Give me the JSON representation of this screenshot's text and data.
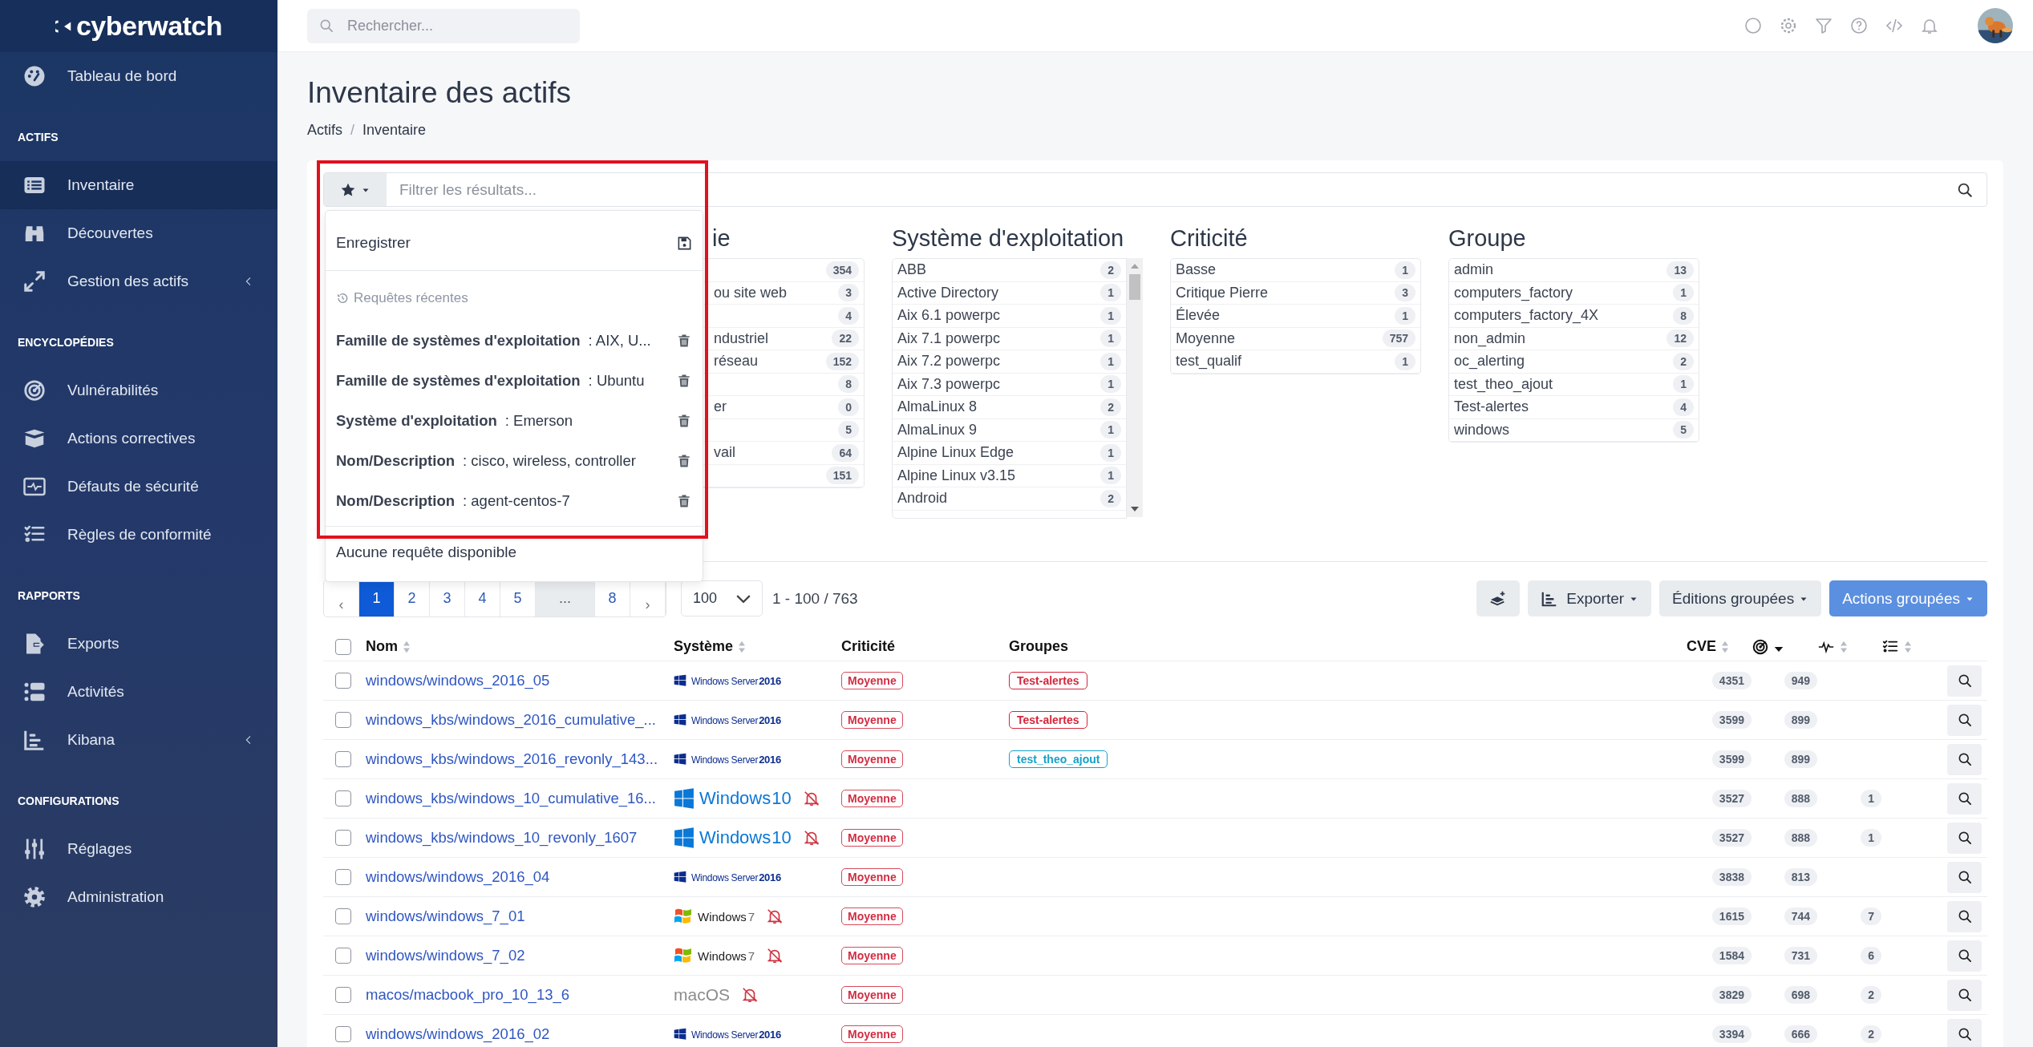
{
  "sidebar": {
    "logo": "cyberwatch",
    "sections": [
      {
        "items": [
          {
            "label": "Tableau de bord",
            "kind": "link",
            "selected": false
          }
        ]
      },
      {
        "title": "ACTIFS",
        "items": [
          {
            "label": "Inventaire",
            "kind": "link",
            "selected": true
          },
          {
            "label": "Découvertes",
            "kind": "link",
            "selected": false
          },
          {
            "label": "Gestion des actifs",
            "kind": "submenu",
            "expanded": false,
            "selected": false
          }
        ]
      },
      {
        "title": "ENCYCLOPÉDIES",
        "items": [
          {
            "label": "Vulnérabilités",
            "kind": "link",
            "selected": false
          },
          {
            "label": "Actions correctives",
            "kind": "link",
            "selected": false
          },
          {
            "label": "Défauts de sécurité",
            "kind": "link",
            "selected": false
          },
          {
            "label": "Règles de conformité",
            "kind": "link",
            "selected": false
          }
        ]
      },
      {
        "title": "RAPPORTS",
        "items": [
          {
            "label": "Exports",
            "kind": "link",
            "selected": false
          },
          {
            "label": "Activités",
            "kind": "link",
            "selected": false
          },
          {
            "label": "Kibana",
            "kind": "submenu",
            "expanded": false,
            "selected": false
          }
        ]
      },
      {
        "title": "CONFIGURATIONS",
        "items": [
          {
            "label": "Réglages",
            "kind": "link",
            "selected": false
          },
          {
            "label": "Administration",
            "kind": "link",
            "selected": false
          }
        ]
      }
    ]
  },
  "topbar": {
    "search": {
      "placeholder": "Rechercher..."
    }
  },
  "page": {
    "title": "Inventaire des actifs",
    "breadcrumb": [
      "Actifs",
      "Inventaire"
    ],
    "breadcrumb_separator": "/"
  },
  "filter": {
    "placeholder": "Filtrer les résultats...",
    "columns": [
      {
        "title": "ie",
        "scrollable": false,
        "items": [
          {
            "count": "354"
          },
          {
            "label": "ou site web",
            "count": "3"
          },
          {
            "count": "4"
          },
          {
            "label": "ndustriel",
            "count": "22"
          },
          {
            "label": "réseau",
            "count": "152"
          },
          {
            "count": "8"
          },
          {
            "label": "er",
            "count": "0"
          },
          {
            "count": "5"
          },
          {
            "label": "vail",
            "count": "64"
          },
          {
            "count": "151"
          }
        ]
      },
      {
        "title": "Système d'exploitation",
        "scrollable": true,
        "items": [
          {
            "label": "ABB",
            "count": "2"
          },
          {
            "label": "Active Directory",
            "count": "1"
          },
          {
            "label": "Aix 6.1 powerpc",
            "count": "1"
          },
          {
            "label": "Aix 7.1 powerpc",
            "count": "1"
          },
          {
            "label": "Aix 7.2 powerpc",
            "count": "1"
          },
          {
            "label": "Aix 7.3 powerpc",
            "count": "1"
          },
          {
            "label": "AlmaLinux 8",
            "count": "2"
          },
          {
            "label": "AlmaLinux 9",
            "count": "1"
          },
          {
            "label": "Alpine Linux Edge",
            "count": "1"
          },
          {
            "label": "Alpine Linux v3.15",
            "count": "1"
          },
          {
            "label": "Android",
            "count": "2"
          }
        ]
      },
      {
        "title": "Criticité",
        "scrollable": false,
        "items": [
          {
            "label": "Basse",
            "count": "1"
          },
          {
            "label": "Critique Pierre",
            "count": "3"
          },
          {
            "label": "Élevée",
            "count": "1"
          },
          {
            "label": "Moyenne",
            "count": "757"
          },
          {
            "label": "test_qualif",
            "count": "1"
          }
        ]
      },
      {
        "title": "Groupe",
        "scrollable": false,
        "items": [
          {
            "label": "admin",
            "count": "13"
          },
          {
            "label": "computers_factory",
            "count": "1"
          },
          {
            "label": "computers_factory_4X",
            "count": "8"
          },
          {
            "label": "non_admin",
            "count": "12"
          },
          {
            "label": "oc_alerting",
            "count": "2"
          },
          {
            "label": "test_theo_ajout",
            "count": "1"
          },
          {
            "label": "Test-alertes",
            "count": "4"
          },
          {
            "label": "windows",
            "count": "5"
          }
        ]
      }
    ]
  },
  "saved_queries": {
    "save_label": "Enregistrer",
    "recent_title": "Requêtes récentes",
    "recent": [
      {
        "field": "Famille de systèmes d'exploitation",
        "value": ": AIX, U..."
      },
      {
        "field": "Famille de systèmes d'exploitation",
        "value": ": Ubuntu"
      },
      {
        "field": "Système d'exploitation",
        "value": ": Emerson"
      },
      {
        "field": "Nom/Description",
        "value": ": cisco, wireless, controller"
      },
      {
        "field": "Nom/Description",
        "value": ": agent-centos-7"
      }
    ],
    "empty_label": "Aucune requête disponible"
  },
  "pagination": {
    "items": [
      {
        "label": "‹",
        "kind": "nav",
        "selected": false
      },
      {
        "label": "1",
        "kind": "page",
        "selected": true
      },
      {
        "label": "2",
        "kind": "page",
        "selected": false
      },
      {
        "label": "3",
        "kind": "page",
        "selected": false
      },
      {
        "label": "4",
        "kind": "page",
        "selected": false
      },
      {
        "label": "5",
        "kind": "page",
        "selected": false
      },
      {
        "label": "...",
        "kind": "gap",
        "selected": false
      },
      {
        "label": "8",
        "kind": "page",
        "selected": false
      },
      {
        "label": "›",
        "kind": "nav",
        "selected": false
      }
    ],
    "per_page": "100",
    "range": "1 - 100 / 763"
  },
  "actions": {
    "export": "Exporter",
    "bulk_edit": "Éditions groupées",
    "bulk_actions": "Actions groupées"
  },
  "table": {
    "select_all": false,
    "columns": [
      {
        "label": "Nom",
        "sortable": true,
        "sorted": false
      },
      {
        "label": "Système",
        "sortable": true,
        "sorted": false
      },
      {
        "label": "Criticité",
        "sortable": false,
        "sorted": false
      },
      {
        "label": "Groupes",
        "sortable": false,
        "sorted": false
      },
      {
        "label": "CVE",
        "sortable": true,
        "sorted": false
      },
      {
        "sortable": true,
        "sorted": true
      },
      {
        "sortable": true,
        "sorted": false
      },
      {
        "sortable": true,
        "sorted": false
      }
    ],
    "rows": [
      {
        "selected": false,
        "name": "windows/windows_2016_05",
        "system": {
          "kind": "windows-server",
          "label": "Windows Server",
          "version": "2016",
          "alerts_muted": false
        },
        "criticality": "Moyenne",
        "groups": [
          {
            "label": "Test-alertes",
            "color": "#d6243a"
          }
        ],
        "cve": "4351",
        "score": "949"
      },
      {
        "selected": false,
        "name": "windows_kbs/windows_2016_cumulative_...",
        "system": {
          "kind": "windows-server",
          "label": "Windows Server",
          "version": "2016",
          "alerts_muted": false
        },
        "criticality": "Moyenne",
        "groups": [
          {
            "label": "Test-alertes",
            "color": "#d6243a"
          }
        ],
        "cve": "3599",
        "score": "899"
      },
      {
        "selected": false,
        "name": "windows_kbs/windows_2016_revonly_143...",
        "system": {
          "kind": "windows-server",
          "label": "Windows Server",
          "version": "2016",
          "alerts_muted": false
        },
        "criticality": "Moyenne",
        "groups": [
          {
            "label": "test_theo_ajout",
            "color": "#17a2c8"
          }
        ],
        "cve": "3599",
        "score": "899"
      },
      {
        "selected": false,
        "name": "windows_kbs/windows_10_cumulative_16...",
        "system": {
          "kind": "windows-10",
          "label": "Windows",
          "version": "10",
          "alerts_muted": true
        },
        "criticality": "Moyenne",
        "cve": "3527",
        "score": "888",
        "events": "1"
      },
      {
        "selected": false,
        "name": "windows_kbs/windows_10_revonly_1607",
        "system": {
          "kind": "windows-10",
          "label": "Windows",
          "version": "10",
          "alerts_muted": true
        },
        "criticality": "Moyenne",
        "cve": "3527",
        "score": "888",
        "events": "1"
      },
      {
        "selected": false,
        "name": "windows/windows_2016_04",
        "system": {
          "kind": "windows-server",
          "label": "Windows Server",
          "version": "2016",
          "alerts_muted": false
        },
        "criticality": "Moyenne",
        "cve": "3838",
        "score": "813"
      },
      {
        "selected": false,
        "name": "windows/windows_7_01",
        "system": {
          "kind": "windows-7",
          "label": "Windows",
          "version": "7",
          "alerts_muted": true
        },
        "criticality": "Moyenne",
        "cve": "1615",
        "score": "744",
        "events": "7"
      },
      {
        "selected": false,
        "name": "windows/windows_7_02",
        "system": {
          "kind": "windows-7",
          "label": "Windows",
          "version": "7",
          "alerts_muted": true
        },
        "criticality": "Moyenne",
        "cve": "1584",
        "score": "731",
        "events": "6"
      },
      {
        "selected": false,
        "name": "macos/macbook_pro_10_13_6",
        "system": {
          "kind": "macos",
          "label": "macOS",
          "alerts_muted": true
        },
        "criticality": "Moyenne",
        "cve": "3829",
        "score": "698",
        "events": "2"
      },
      {
        "selected": false,
        "name": "windows/windows_2016_02",
        "system": {
          "kind": "windows-server",
          "label": "Windows Server",
          "version": "2016",
          "alerts_muted": false
        },
        "criticality": "Moyenne",
        "cve": "3394",
        "score": "666",
        "events": "2"
      }
    ]
  }
}
